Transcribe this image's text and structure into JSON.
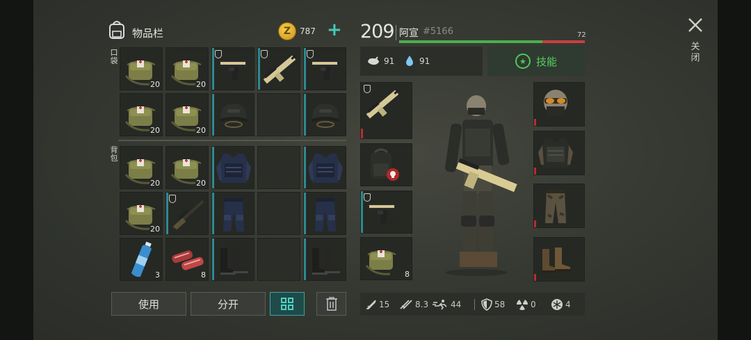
{
  "inventory": {
    "title": "物品栏",
    "coins": "787",
    "add": "+",
    "pocket_label": "口袋",
    "backpack_label": "背包",
    "counts": {
      "p1": "20",
      "p2": "20",
      "p6": "20",
      "p7": "20",
      "b1": "20",
      "b2": "20",
      "b6": "20",
      "b11": "3",
      "b12": "8"
    }
  },
  "player": {
    "level": "209",
    "name": "阿宣",
    "tag": "#5166",
    "hp_value": "72",
    "hp_fraction": 0.77
  },
  "status": {
    "food": "91",
    "water": "91"
  },
  "skills_button": "技能",
  "equip": {
    "med_count": "8"
  },
  "buttons": {
    "use": "使用",
    "split": "分开"
  },
  "close_label": "关闭",
  "stats": {
    "melee": "15",
    "ranged": "8.3",
    "speed": "44",
    "armor": "58",
    "radiation": "0",
    "cold": "4"
  }
}
